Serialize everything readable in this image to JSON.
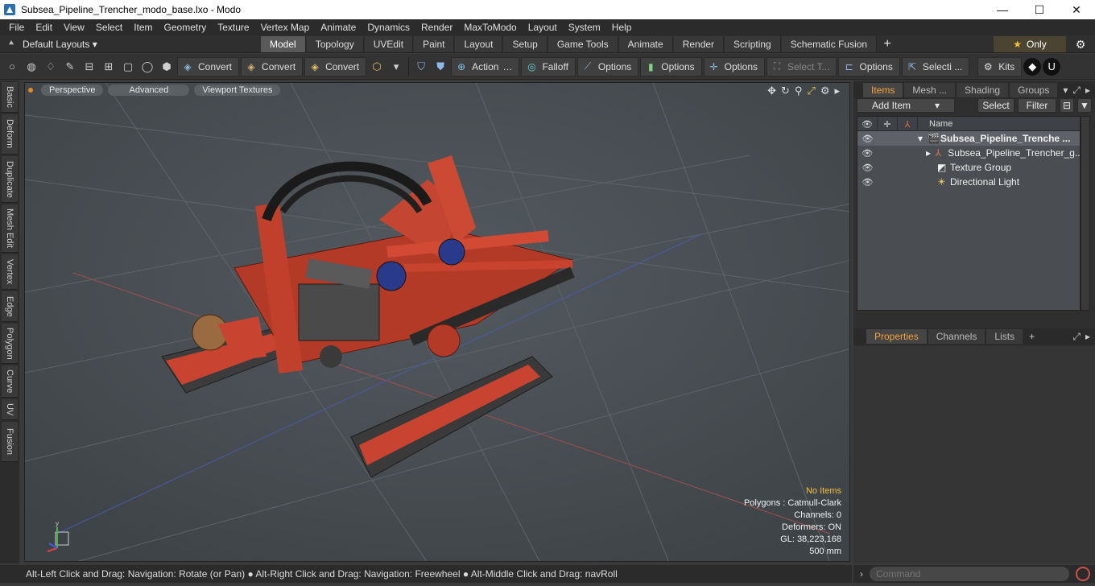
{
  "window": {
    "title": "Subsea_Pipeline_Trencher_modo_base.lxo - Modo",
    "min": "—",
    "max": "☐",
    "close": "✕"
  },
  "menu": [
    "File",
    "Edit",
    "View",
    "Select",
    "Item",
    "Geometry",
    "Texture",
    "Vertex Map",
    "Animate",
    "Dynamics",
    "Render",
    "MaxToModo",
    "Layout",
    "System",
    "Help"
  ],
  "layout": {
    "default_layouts": "Default Layouts ▾",
    "tabs": [
      "Model",
      "Topology",
      "UVEdit",
      "Paint",
      "Layout",
      "Setup",
      "Game Tools",
      "Animate",
      "Render",
      "Scripting",
      "Schematic Fusion"
    ],
    "active_tab": "Model",
    "only": "Only"
  },
  "toolbar": {
    "convert1": "Convert",
    "convert2": "Convert",
    "convert3": "Convert",
    "action": "Action",
    "falloff": "Falloff",
    "options1": "Options",
    "options2": "Options",
    "options3": "Options",
    "options4": "Options",
    "select_t": "Select T...",
    "selecti": "Selecti ...",
    "kits": "Kits"
  },
  "left_tabs": [
    "Basic",
    "Deform",
    "Duplicate",
    "Mesh Edit",
    "Vertex",
    "Edge",
    "Polygon",
    "Curve",
    "UV",
    "Fusion"
  ],
  "viewport": {
    "perspective": "Perspective",
    "advanced": "Advanced",
    "textures": "Viewport Textures",
    "stats": {
      "no_items": "No Items",
      "polygons": "Polygons : Catmull-Clark",
      "channels": "Channels: 0",
      "deformers": "Deformers: ON",
      "gl": "GL: 38,223,168",
      "scale": "500 mm"
    }
  },
  "status": "Alt-Left Click and Drag: Navigation: Rotate (or Pan) ● Alt-Right Click and Drag: Navigation: Freewheel ● Alt-Middle Click and Drag: navRoll",
  "panel_top": {
    "tabs": [
      "Items",
      "Mesh ...",
      "Shading",
      "Groups"
    ],
    "add_item": "Add Item",
    "select": "Select",
    "filter": "Filter",
    "name_header": "Name",
    "items": [
      "Subsea_Pipeline_Trenche ...",
      "Subsea_Pipeline_Trencher_g...",
      "Texture Group",
      "Directional Light"
    ]
  },
  "panel_bottom": {
    "tabs": [
      "Properties",
      "Channels",
      "Lists"
    ]
  },
  "command": {
    "placeholder": "Command"
  }
}
